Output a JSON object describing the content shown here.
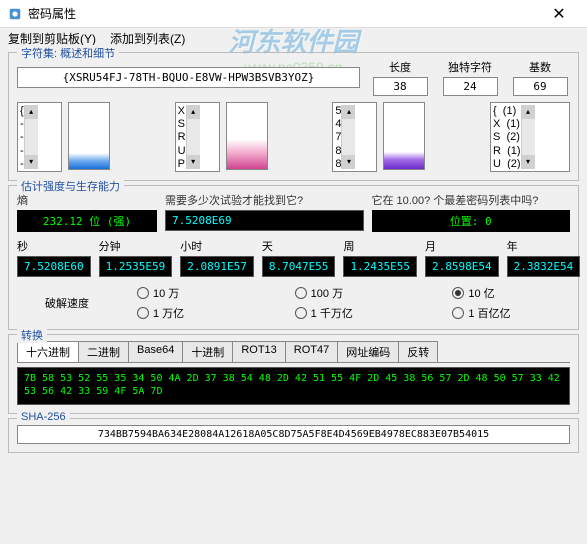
{
  "title": "密码属性",
  "menu": {
    "copy": "复制到剪贴板(Y)",
    "add": "添加到列表(Z)"
  },
  "group1": {
    "legend": "字符集: 概述和细节",
    "password": "{XSRU54FJ-78TH-BQUO-E8VW-HPW3BSVB3YOZ}",
    "length_label": "长度",
    "length": "38",
    "unique_label": "独特字符",
    "unique": "24",
    "base_label": "基数",
    "base": "69",
    "list1": "{\n-\n-\n-\n-\n}",
    "list2": "X\nS\nR\nU\nP",
    "list3": "5\n4\n7\n8\n8",
    "list4": "{  (1)\nX  (1)\nS  (2)\nR  (1)\nU  (2)"
  },
  "group2": {
    "legend": "估计强度与生存能力",
    "entropy_label": "熵",
    "entropy": "232.12 位 (强)",
    "attempts_label": "需要多少次试验才能找到它?",
    "attempts": "7.5208E69",
    "worst_label": "它在 10.00? 个最差密码列表中吗?",
    "worst": "位置: 0",
    "cols": [
      {
        "label": "秒",
        "val": "7.5208E60"
      },
      {
        "label": "分钟",
        "val": "1.2535E59"
      },
      {
        "label": "小时",
        "val": "2.0891E57"
      },
      {
        "label": "天",
        "val": "8.7047E55"
      },
      {
        "label": "周",
        "val": "1.2435E55"
      },
      {
        "label": "月",
        "val": "2.8598E54"
      },
      {
        "label": "年",
        "val": "2.3832E54"
      }
    ],
    "speed_label": "破解速度",
    "radios": [
      "10 万",
      "100 万",
      "10 亿",
      "1 万亿",
      "1 千万亿",
      "1 百亿亿"
    ],
    "selected": 2
  },
  "group3": {
    "legend": "转换",
    "tabs": [
      "十六进制",
      "二进制",
      "Base64",
      "十进制",
      "ROT13",
      "ROT47",
      "网址编码",
      "反转"
    ],
    "hex": "7B 58 53 52 55 35 34 50 4A 2D 37 38 54 48 2D 42 51 55 4F 2D 45 38 56 57 2D 48 50 57 33 42 53 56 42 33 59 4F 5A 7D"
  },
  "group4": {
    "legend": "SHA-256",
    "val": "734BB7594BA634E28084A12618A05C8D75A5F8E4D4569EB4978EC883E07B54015"
  },
  "watermark": {
    "text": "河东软件园",
    "url": "www.pc0359.cn"
  }
}
